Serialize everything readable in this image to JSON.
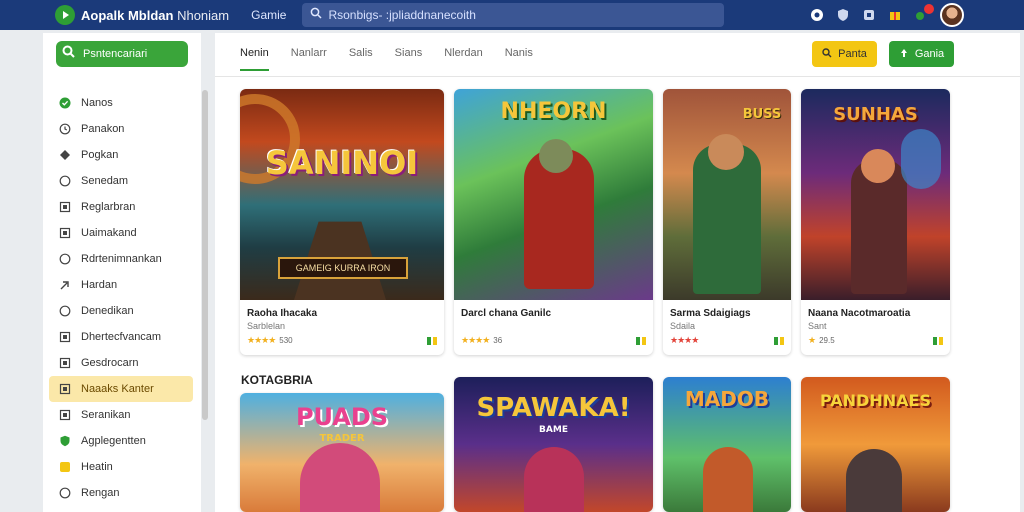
{
  "topbar": {
    "app_title_bold": "Aopalk Mbldan",
    "app_title_light": "Nhoniam",
    "nav_link": "Gamie",
    "search_placeholder": "Rsonbigs- :jpliaddnanecoith"
  },
  "sidebar": {
    "search_label": "Psntencariari",
    "items": [
      {
        "label": "Nanos",
        "icon": "check-circle-icon"
      },
      {
        "label": "Panakon",
        "icon": "clock-icon"
      },
      {
        "label": "Pogkan",
        "icon": "diamond-icon"
      },
      {
        "label": "Senedam",
        "icon": "circle-icon"
      },
      {
        "label": "Reglarbran",
        "icon": "square-icon"
      },
      {
        "label": "Uaimakand",
        "icon": "square-icon"
      },
      {
        "label": "Rdrtenimnankan",
        "icon": "circle-icon"
      },
      {
        "label": "Hardan",
        "icon": "arrow-icon"
      },
      {
        "label": "Denedikan",
        "icon": "circle-icon"
      },
      {
        "label": "Dhertecfvancam",
        "icon": "square-icon"
      },
      {
        "label": "Gesdrocarn",
        "icon": "square-icon"
      },
      {
        "label": "Naaaks Kanter",
        "icon": "square-icon",
        "active": true
      },
      {
        "label": "Seranikan",
        "icon": "square-icon"
      },
      {
        "label": "Agplegentten",
        "icon": "shield-icon"
      },
      {
        "label": "Heatin",
        "icon": "badge-icon"
      },
      {
        "label": "Rengan",
        "icon": "circle-icon"
      }
    ]
  },
  "main": {
    "tabs": [
      "Nenin",
      "Nanlarr",
      "Salis",
      "Sians",
      "Nlerdan",
      "Nanis"
    ],
    "active_tab": 0,
    "btn_yellow": "Panta",
    "btn_green": "Gania",
    "section_title": "KOTAGBRIA",
    "cards": [
      {
        "title": "Raoha Ihacaka",
        "sub": "Sarblelan",
        "rating": "530",
        "art_title": "SANINOI",
        "art_sub": "GAMEIG KURRA IRON"
      },
      {
        "title": "Darcl chana Ganilc",
        "sub": "",
        "rating": "36",
        "art_title": "NHEORN"
      },
      {
        "title": "Sarma Sdaigiags",
        "sub": "Sdaila",
        "rating": "",
        "art_title": "BUSS"
      },
      {
        "title": "Naana Nacotmaroatia",
        "sub": "Sant",
        "rating": "29.5",
        "art_title": "SUNHAS"
      }
    ],
    "cards_row2": [
      {
        "art_title": "PUADS",
        "art_sub": "TRADER"
      },
      {
        "art_title": "SPAWAKA!",
        "art_sub": "BAME"
      },
      {
        "art_title": "MADOB"
      },
      {
        "art_title": "PANDHNAES"
      }
    ]
  },
  "colors": {
    "topbar": "#1b3a7a",
    "accent_green": "#2e9e35",
    "accent_yellow": "#f3c613",
    "active_item": "#fbe8a9"
  }
}
